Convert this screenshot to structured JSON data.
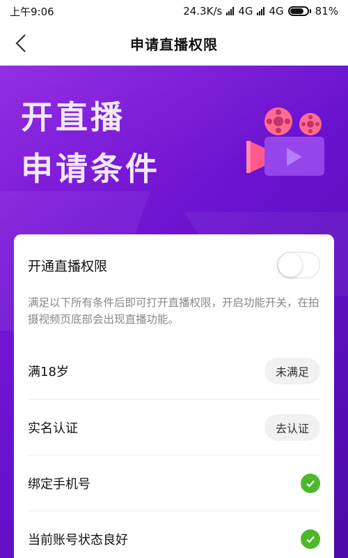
{
  "status_bar": {
    "time": "上午9:06",
    "net_speed": "24.3K/s",
    "network1": "4G",
    "network2": "4G",
    "battery": "81%",
    "battery_level": 0.81
  },
  "nav": {
    "title": "申请直播权限",
    "back_icon": "chevron-left-icon"
  },
  "banner": {
    "line1": "开直播",
    "line2": "申请条件",
    "illustration": "film-camera-icon"
  },
  "card": {
    "toggle_label": "开通直播权限",
    "toggle_on": false,
    "description": "满足以下所有条件后即可打开直播权限，开启功能开关，在拍摄视频页底部会出现直播功能。",
    "conditions": [
      {
        "label": "满18岁",
        "status": "未满足"
      },
      {
        "label": "实名认证",
        "status": "去认证"
      },
      {
        "label": "绑定手机号",
        "status_icon": "check-circle-icon"
      },
      {
        "label": "当前账号状态良好",
        "status_icon": "check-circle-icon"
      }
    ]
  },
  "colors": {
    "banner_start": "#8a1fe0",
    "banner_end": "#4d0aa8",
    "check_green": "#4cb82a",
    "pill_bg": "#f1f1f1"
  }
}
